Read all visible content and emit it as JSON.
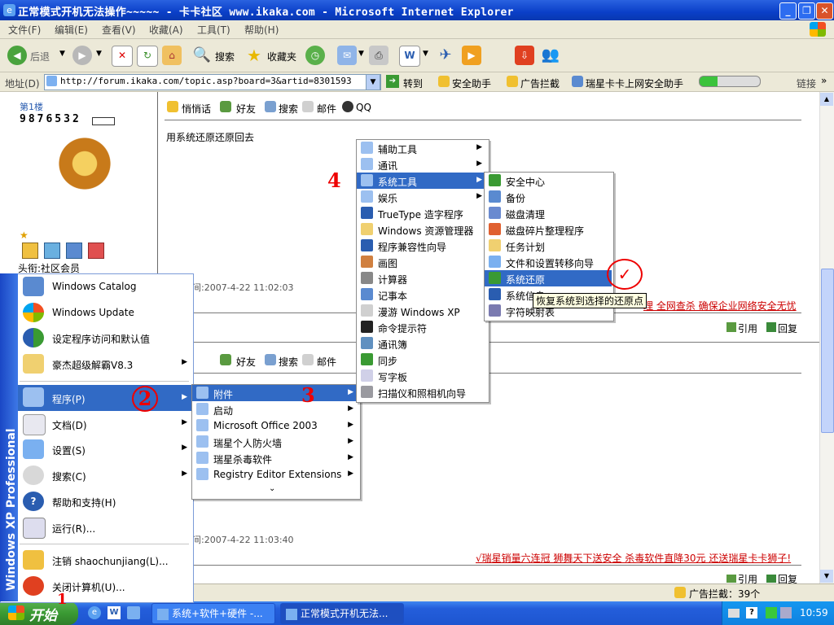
{
  "window": {
    "title": "正常模式开机无法操作~~~~~ - 卡卡社区 www.ikaka.com - Microsoft Internet Explorer"
  },
  "menubar": [
    "文件(F)",
    "编辑(E)",
    "查看(V)",
    "收藏(A)",
    "工具(T)",
    "帮助(H)"
  ],
  "toolbar": {
    "back": "后退",
    "search": "搜索",
    "favorites": "收藏夹"
  },
  "address": {
    "label": "地址(D)",
    "url": "http://forum.ikaka.com/topic.asp?board=3&artid=8301593",
    "go": "转到",
    "links": [
      "安全助手",
      "广告拦截",
      "瑞星卡卡上网安全助手"
    ],
    "links_label": "链接"
  },
  "post": {
    "floor": "第1楼",
    "username": "9876532",
    "actions": [
      "悄悄话",
      "好友",
      "搜索",
      "邮件",
      "QQ"
    ],
    "message": "用系统还原还原回去",
    "role": "头衔:社区会员",
    "time1": "间:2007-4-22 11:02:03",
    "time2": "间:2007-4-22 11:03:40",
    "ad1": "理 全网查杀 确保企业网络安全无忧",
    "ad2": "√瑞星销量六连冠 狮舞天下送安全 杀毒软件直降30元 还送瑞星卡卡狮子!",
    "quote": "引用",
    "reply": "回复"
  },
  "status": {
    "adblock": "广告拦截：39个"
  },
  "taskbar": {
    "start": "开始",
    "tasks": [
      "系统+软件+硬件 -...",
      "正常模式开机无法..."
    ],
    "clock": "10:59"
  },
  "start_menu": {
    "stripe": "Windows XP Professional",
    "top": [
      "Windows Catalog",
      "Windows Update",
      "设定程序访问和默认值",
      "豪杰超级解霸V8.3"
    ],
    "main": [
      "程序(P)",
      "文档(D)",
      "设置(S)",
      "搜索(C)",
      "帮助和支持(H)",
      "运行(R)..."
    ],
    "bottom": [
      "注销 shaochunjiang(L)...",
      "关闭计算机(U)..."
    ]
  },
  "programs_menu": [
    "附件",
    "启动",
    "Microsoft Office 2003",
    "瑞星个人防火墙",
    "瑞星杀毒软件",
    "Registry Editor Extensions"
  ],
  "accessories_menu": [
    "辅助工具",
    "通讯",
    "系统工具",
    "娱乐",
    "TrueType 造字程序",
    "Windows 资源管理器",
    "程序兼容性向导",
    "画图",
    "计算器",
    "记事本",
    "漫游 Windows XP",
    "命令提示符",
    "通讯簿",
    "同步",
    "写字板",
    "扫描仪和照相机向导"
  ],
  "system_tools_menu": [
    "安全中心",
    "备份",
    "磁盘清理",
    "磁盘碎片整理程序",
    "任务计划",
    "文件和设置转移向导",
    "系统还原",
    "系统信息",
    "字符映射表"
  ],
  "tooltip": "恢复系统到选择的还原点",
  "annotations": [
    "1",
    "2",
    "3",
    "4"
  ],
  "colors": {
    "highlight": "#316ac5",
    "titlebar": "#0a3fc8",
    "taskbar": "#245edb"
  }
}
